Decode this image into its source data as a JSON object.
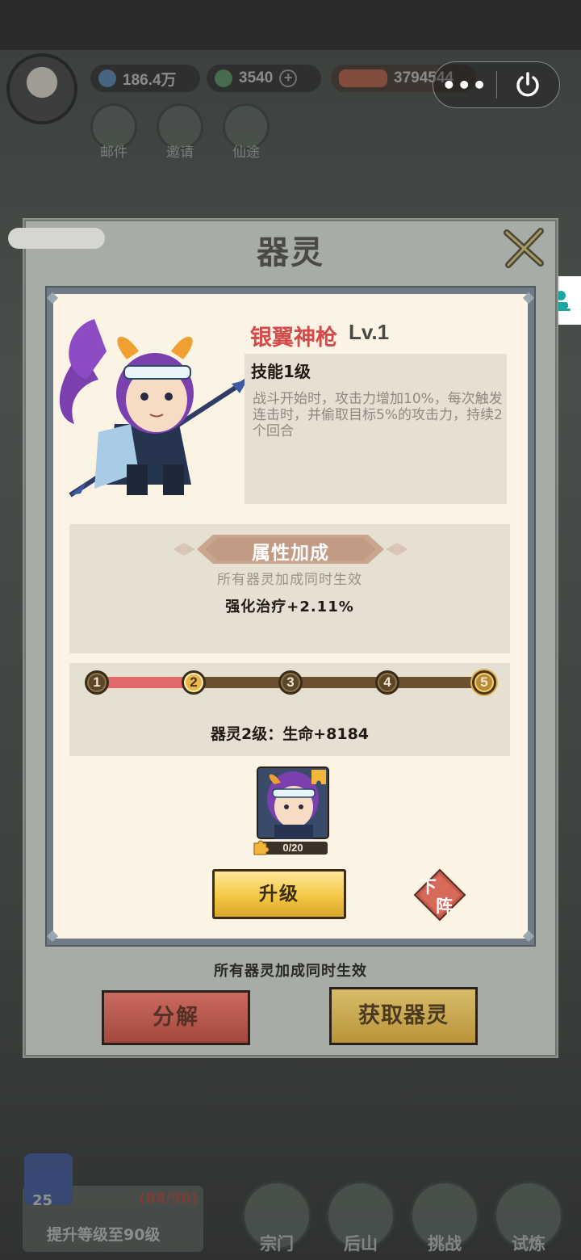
{
  "topbar": {
    "silver": "186.4万",
    "jade": "3540",
    "cultivation_value": "3794544",
    "buttons": [
      {
        "label": "邮件"
      },
      {
        "label": "邀请"
      },
      {
        "label": "仙途"
      }
    ]
  },
  "capsule": {
    "more_label": "•••"
  },
  "dialog": {
    "title": "器灵",
    "spirit": {
      "name": "银翼神枪",
      "level": "Lv.1",
      "skill_title": "技能1级",
      "skill_desc": "战斗开始时，攻击力增加10%，每次触发连击时，并偷取目标5%的攻击力，持续2个回合"
    },
    "attributes": {
      "title": "属性加成",
      "subtitle": "所有器灵加成同时生效",
      "value": "强化治疗+2.11%"
    },
    "progress": {
      "nodes": [
        "1",
        "2",
        "3",
        "4",
        "5"
      ],
      "current": 2,
      "fill_fraction": 0.25,
      "next_level_text": "器灵2级：生命+8184"
    },
    "fragment": {
      "count": "0/20"
    },
    "upgrade_label": "升级",
    "unequip_label_top": "下",
    "unequip_label_bottom": "阵",
    "footer_note": "所有器灵加成同时生效",
    "decompose_label": "分解",
    "obtain_label": "获取器灵"
  },
  "bottom": {
    "level": "25",
    "exp": "(88/90)",
    "task": "提升等级至90级",
    "nav": [
      {
        "label": "宗门"
      },
      {
        "label": "后山"
      },
      {
        "label": "挑战"
      },
      {
        "label": "试炼"
      }
    ]
  },
  "colors": {
    "name_red": "#d54a4a",
    "progress_fill": "#e06a6a",
    "upgrade_gold": "#f3c845",
    "card_bg": "#fbf3e3"
  }
}
